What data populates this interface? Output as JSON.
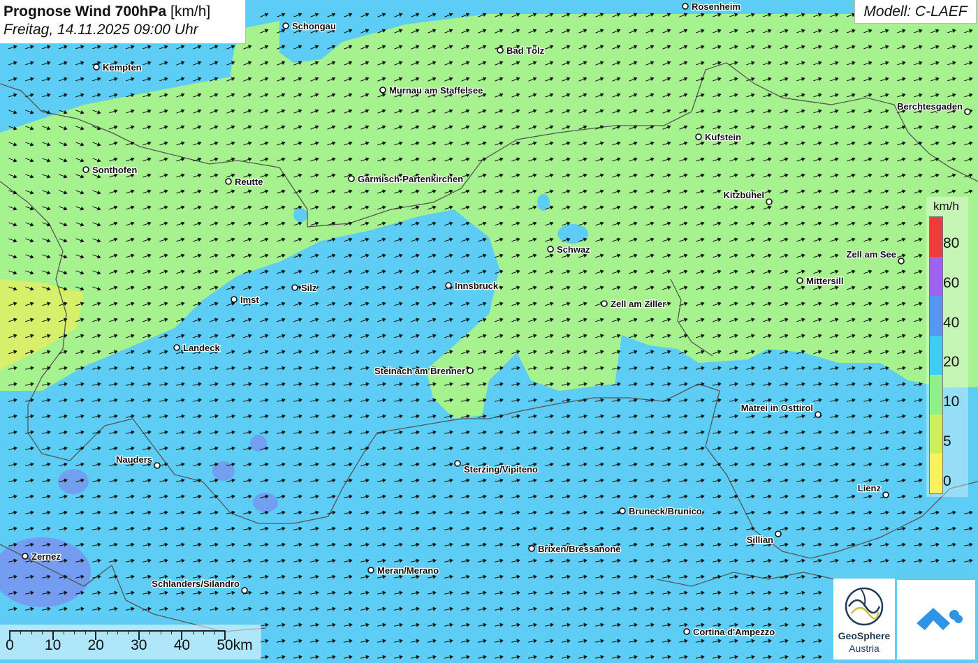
{
  "title": {
    "label": "Prognose Wind 700hPa",
    "unit": "[km/h]",
    "datetime": "Freitag, 14.11.2025 09:00 Uhr"
  },
  "model": "Modell: C-LAEF",
  "legend": {
    "unit": "km/h",
    "classes": [
      {
        "value": "0",
        "color": "#f8f25c"
      },
      {
        "value": "5",
        "color": "#cfee5c"
      },
      {
        "value": "10",
        "color": "#8ff08a"
      },
      {
        "value": "20",
        "color": "#3fcdf4"
      },
      {
        "value": "40",
        "color": "#5596f0"
      },
      {
        "value": "60",
        "color": "#9c64ee"
      },
      {
        "value": "80",
        "color": "#ee3c3c"
      }
    ]
  },
  "scalebar": {
    "labels": [
      "0",
      "10",
      "20",
      "30",
      "40",
      "50km"
    ]
  },
  "colors": {
    "green_zone": "#a6f28e",
    "blue_zone": "#5ecdf5",
    "purple_spots": "#7c8cf0",
    "yellow_zone": "#d8ef6a",
    "borders": "#555555",
    "arrows": "#111111"
  },
  "cities": [
    {
      "name": "Rosenheim"
    },
    {
      "name": "Schongau"
    },
    {
      "name": "Kempten"
    },
    {
      "name": "Bad Tölz"
    },
    {
      "name": "Murnau am Staffelsee"
    },
    {
      "name": "Berchtesgaden"
    },
    {
      "name": "Kufstein"
    },
    {
      "name": "Sonthofen"
    },
    {
      "name": "Reutte"
    },
    {
      "name": "Garmisch-Partenkirchen"
    },
    {
      "name": "Kitzbühel"
    },
    {
      "name": "Schwaz"
    },
    {
      "name": "Zell am See"
    },
    {
      "name": "Mittersill"
    },
    {
      "name": "Silz"
    },
    {
      "name": "Innsbruck"
    },
    {
      "name": "Imst"
    },
    {
      "name": "Zell am Ziller"
    },
    {
      "name": "Landeck"
    },
    {
      "name": "Steinach am Brenner"
    },
    {
      "name": "Matrei in Osttirol"
    },
    {
      "name": "Nauders"
    },
    {
      "name": "Sterzing/Vipiteno"
    },
    {
      "name": "Lienz"
    },
    {
      "name": "Bruneck/Brunico"
    },
    {
      "name": "Sillian"
    },
    {
      "name": "Brixen/Bressanone"
    },
    {
      "name": "Zernez"
    },
    {
      "name": "Meran/Merano"
    },
    {
      "name": "Schlanders/Silandro"
    },
    {
      "name": "Cortina d'Ampezzo"
    }
  ],
  "logos": {
    "geosphere_name": "GeoSphere",
    "geosphere_sub": "Austria"
  }
}
